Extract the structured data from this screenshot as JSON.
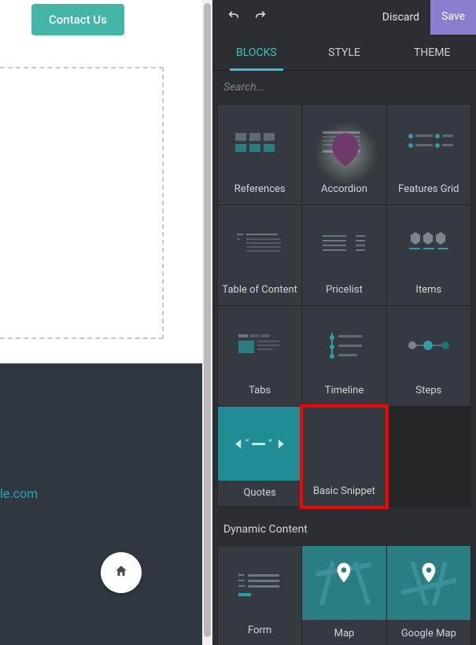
{
  "preview": {
    "contact_button": "Contact Us",
    "footer_link_fragment": "le.com"
  },
  "toolbar": {
    "discard": "Discard",
    "save": "Save"
  },
  "tabs": {
    "blocks": "BLOCKS",
    "style": "STYLE",
    "theme": "THEME",
    "active": "blocks"
  },
  "search": {
    "placeholder": "Search..."
  },
  "blocks": [
    {
      "label": "References"
    },
    {
      "label": "Accordion"
    },
    {
      "label": "Features Grid"
    },
    {
      "label": "Table of Content"
    },
    {
      "label": "Pricelist"
    },
    {
      "label": "Items"
    },
    {
      "label": "Tabs"
    },
    {
      "label": "Timeline"
    },
    {
      "label": "Steps"
    },
    {
      "label": "Quotes"
    },
    {
      "label": "Basic Snippet"
    }
  ],
  "section2_title": "Dynamic Content",
  "blocks2": [
    {
      "label": "Form"
    },
    {
      "label": "Map"
    },
    {
      "label": "Google Map"
    }
  ],
  "highlight": {
    "target_block_index": 10
  },
  "colors": {
    "accent": "#3fbfc1",
    "teal_button": "#42b5a6",
    "save_button": "#8c7dd1",
    "highlight": "#ff0000"
  }
}
